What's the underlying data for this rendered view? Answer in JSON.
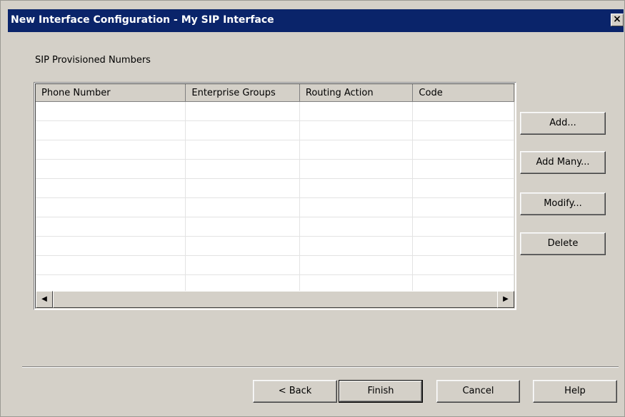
{
  "window": {
    "title": "New Interface Configuration - My SIP Interface",
    "close_glyph": "×"
  },
  "section_label": "SIP Provisioned Numbers",
  "table": {
    "columns": [
      "Phone Number",
      "Enterprise Groups",
      "Routing Action",
      "Code"
    ],
    "rows": []
  },
  "side_buttons": {
    "add": "Add...",
    "add_many": "Add Many...",
    "modify": "Modify...",
    "delete": "Delete"
  },
  "footer_buttons": {
    "back": "< Back",
    "finish": "Finish",
    "cancel": "Cancel",
    "help": "Help"
  },
  "scrollbar": {
    "left_arrow": "◀",
    "right_arrow": "▶"
  },
  "colors": {
    "titlebar": "#0a246a",
    "face": "#d4d0c8"
  }
}
